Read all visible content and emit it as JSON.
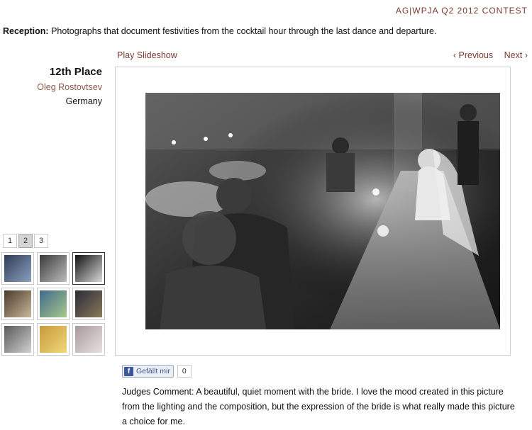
{
  "header": {
    "contest_title": "AG|WPJA Q2 2012 CONTEST",
    "category_label": "Reception:",
    "category_description": "Photographs that document festivities from the cocktail hour through the last dance and departure."
  },
  "nav": {
    "play_slideshow": "Play Slideshow",
    "previous": "‹ Previous",
    "next": "Next ›"
  },
  "entry": {
    "place": "12th Place",
    "photographer": "Oleg Rostovtsev",
    "country": "Germany"
  },
  "photo": {
    "description_icon": "wedding-reception-photo"
  },
  "pager": {
    "pages": [
      "1",
      "2",
      "3"
    ],
    "active_page": "2"
  },
  "thumbnails": [
    {
      "icon": "thumbnail-photo"
    },
    {
      "icon": "thumbnail-photo"
    },
    {
      "icon": "thumbnail-photo",
      "selected": true
    },
    {
      "icon": "thumbnail-photo"
    },
    {
      "icon": "thumbnail-photo"
    },
    {
      "icon": "thumbnail-photo"
    },
    {
      "icon": "thumbnail-photo"
    },
    {
      "icon": "thumbnail-photo"
    },
    {
      "icon": "thumbnail-photo"
    }
  ],
  "social": {
    "like_label": "Gefällt mir",
    "like_count": "0",
    "brand_color": "#3b5998"
  },
  "judges": {
    "comment": "Judges Comment: A beautiful, quiet moment with the bride. I love the mood created in this picture from the lighting and the composition, but the expression of the bride is what really made this picture a choice for me."
  },
  "colors": {
    "accent": "#7a3a2e",
    "photographer_link": "#8a5a4a"
  }
}
